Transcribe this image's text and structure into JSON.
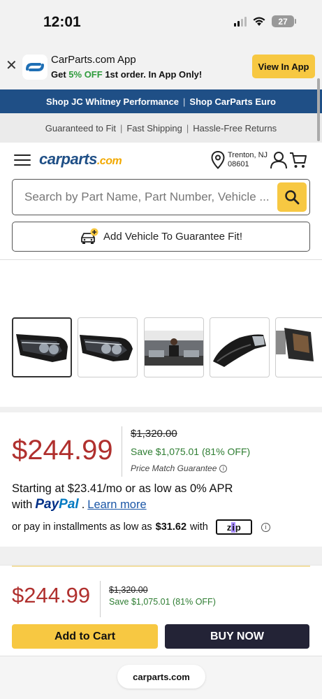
{
  "status_bar": {
    "time": "12:01",
    "battery": "27"
  },
  "app_banner": {
    "title": "CarParts.com App",
    "subtitle_prefix": "Get ",
    "subtitle_highlight": "5% OFF",
    "subtitle_suffix": " 1st order. In App Only!",
    "button_label": "View In App",
    "highlight_color": "#2e9b3c",
    "button_color": "#f7c842"
  },
  "promo_bar": {
    "link1": "Shop JC Whitney Performance",
    "separator": "|",
    "link2": "Shop CarParts Euro",
    "bg_color": "#1f4f86"
  },
  "benefits_bar": {
    "items": [
      "Guaranteed to Fit",
      "Fast Shipping",
      "Hassle-Free Returns"
    ],
    "separator": "|"
  },
  "header": {
    "logo_main": "carparts",
    "logo_suffix": ".com",
    "location_city": "Trenton, NJ",
    "location_zip": "08601"
  },
  "search": {
    "placeholder": "Search by Part Name, Part Number, Vehicle ..."
  },
  "vehicle": {
    "button_label": "Add Vehicle To Guarantee Fit!"
  },
  "gallery": {
    "thumbnails": [
      {
        "alt": "Headlight front view",
        "icon": "headlight-image"
      },
      {
        "alt": "Headlight angled view",
        "icon": "headlight-image"
      },
      {
        "alt": "Product video",
        "icon": "video-thumbnail"
      },
      {
        "alt": "Headlight side view",
        "icon": "headlight-image"
      },
      {
        "alt": "Headlight rear view",
        "icon": "headlight-image"
      }
    ]
  },
  "pricing": {
    "price": "$244.99",
    "original_price": "$1,320.00",
    "savings": "Save $1,075.01 (81% OFF)",
    "price_match": "Price Match Guarantee",
    "price_color": "#b0302e",
    "save_color": "#2e7d32"
  },
  "financing": {
    "paypal_line1": "Starting at $23.41/mo or as low as 0% APR",
    "paypal_with": "with",
    "paypal_pay": "Pay",
    "paypal_pal": "Pal",
    "paypal_dot": ".",
    "learn_more": "Learn more",
    "zip_prefix": "or pay in installments as low as",
    "zip_amount": "$31.62",
    "zip_with": "with",
    "zip_logo": "zip"
  },
  "sticky_bar": {
    "price": "$244.99",
    "original_price": "$1,320.00",
    "savings": "Save $1,075.01 (81% OFF)",
    "add_to_cart": "Add to Cart",
    "buy_now": "BUY NOW"
  },
  "browser": {
    "url": "carparts.com"
  }
}
